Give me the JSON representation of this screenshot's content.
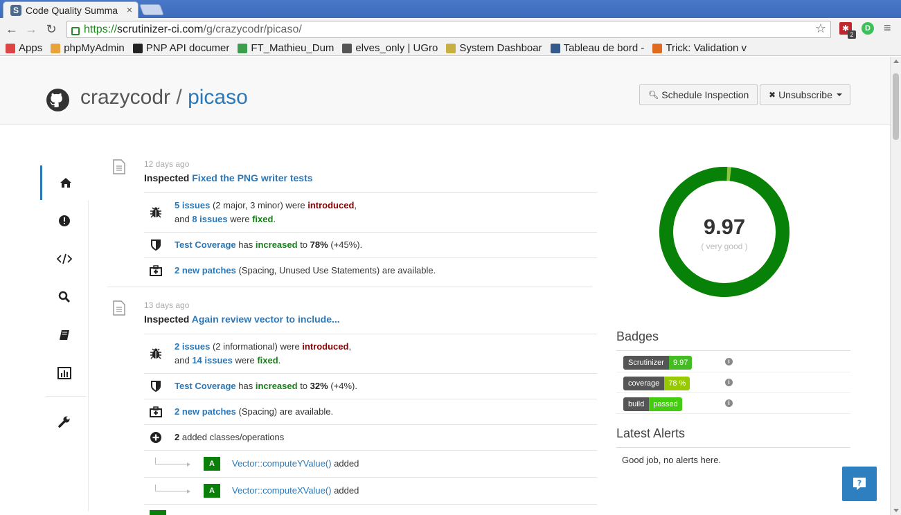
{
  "browser": {
    "tab_title": "Code Quality Summa",
    "tab_close": "×",
    "url_scheme": "https://",
    "url_host": "scrutinizer-ci.com",
    "url_path": "/g/crazycodr/picaso/",
    "extension_count": "2",
    "extension_letter": "D",
    "bookmarks": [
      {
        "label": "Apps",
        "color": "#d44"
      },
      {
        "label": "phpMyAdmin",
        "color": "#e8a33c"
      },
      {
        "label": "PNP API documer",
        "color": "#222"
      },
      {
        "label": "FT_Mathieu_Dum",
        "color": "#3a9e4a"
      },
      {
        "label": "elves_only | UGro",
        "color": "#555"
      },
      {
        "label": "System Dashboar",
        "color": "#c8b040"
      },
      {
        "label": "Tableau de bord -",
        "color": "#335a8a"
      },
      {
        "label": "Trick: Validation v",
        "color": "#e06a20"
      }
    ]
  },
  "header": {
    "owner": "crazycodr",
    "separator": "/",
    "repo": "picaso",
    "schedule_button": "Schedule Inspection",
    "unsubscribe_button": "Unsubscribe"
  },
  "feed": [
    {
      "time": "12 days ago",
      "prefix": "Inspected",
      "title": "Fixed the PNG writer tests",
      "issues_new": "5 issues",
      "issues_new_detail": "(2 major, 3 minor) were",
      "introduced": "introduced",
      "and": "and",
      "issues_fixed": "8 issues",
      "were": "were",
      "fixed": "fixed",
      "coverage_link": "Test Coverage",
      "coverage_has": "has",
      "coverage_change": "increased",
      "coverage_to": "to",
      "coverage_value": "78%",
      "coverage_delta": "(+45%).",
      "patches_link": "2 new patches",
      "patches_detail": "(Spacing, Unused Use Statements) are available."
    },
    {
      "time": "13 days ago",
      "prefix": "Inspected",
      "title": "Again review vector to include...",
      "issues_new": "2 issues",
      "issues_new_detail": "(2 informational) were",
      "introduced": "introduced",
      "and": "and",
      "issues_fixed": "14 issues",
      "were": "were",
      "fixed": "fixed",
      "coverage_link": "Test Coverage",
      "coverage_has": "has",
      "coverage_change": "increased",
      "coverage_to": "to",
      "coverage_value": "32%",
      "coverage_delta": "(+4%).",
      "patches_link": "2 new patches",
      "patches_detail": "(Spacing) are available.",
      "classes_count": "2",
      "classes_text": "added classes/operations",
      "operations": [
        {
          "grade": "A",
          "name": "Vector::computeYValue()",
          "status": "added"
        },
        {
          "grade": "A",
          "name": "Vector::computeXValue()",
          "status": "added"
        }
      ]
    }
  ],
  "score": {
    "value": "9.97",
    "label": "( very good )",
    "fraction": 0.99,
    "main_color": "#078107",
    "accent_color": "#8dc63f"
  },
  "badges": {
    "title": "Badges",
    "items": [
      {
        "left": "Scrutinizer",
        "right": "9.97",
        "color": "#44bb22"
      },
      {
        "left": "coverage",
        "right": "78 %",
        "color": "#97ca00"
      },
      {
        "left": "build",
        "right": "passed",
        "color": "#44cc11"
      }
    ],
    "info": "i"
  },
  "alerts": {
    "title": "Latest Alerts",
    "text": "Good job, no alerts here."
  }
}
